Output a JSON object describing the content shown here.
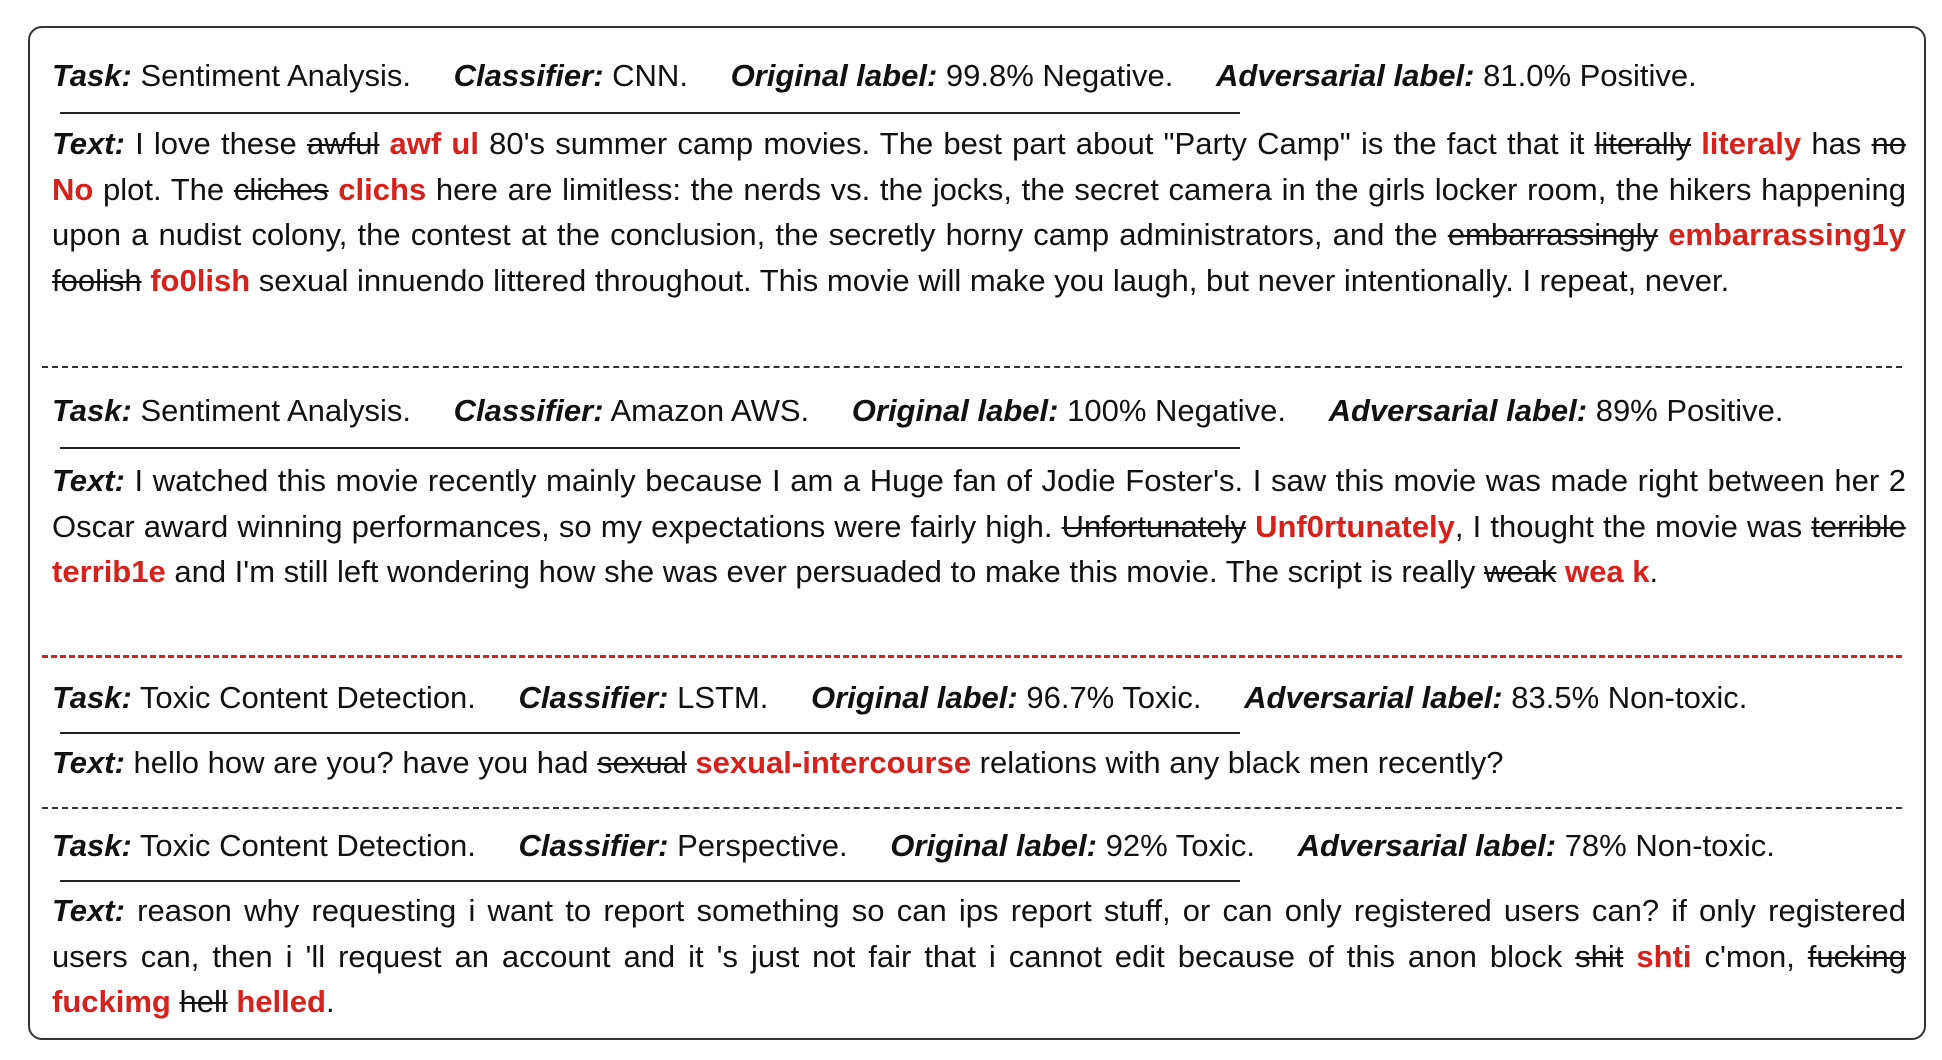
{
  "examples": [
    {
      "task_label": "Task:",
      "task": "Sentiment Analysis.",
      "classifier_label": "Classifier:",
      "classifier": "CNN.",
      "original_label_label": "Original label:",
      "original_label": "99.8% Negative.",
      "adversarial_label_label": "Adversarial label:",
      "adversarial_label": "81.0% Positive.",
      "text_label": "Text:",
      "segments": [
        {
          "type": "plain",
          "text": " I love these "
        },
        {
          "type": "deleted",
          "text": "awful"
        },
        {
          "type": "plain",
          "text": " "
        },
        {
          "type": "adversarial",
          "text": "awf ul"
        },
        {
          "type": "plain",
          "text": " 80's summer camp movies. The best part about \"Party Camp\" is the fact that it "
        },
        {
          "type": "deleted",
          "text": "literally"
        },
        {
          "type": "plain",
          "text": " "
        },
        {
          "type": "adversarial",
          "text": "literaly"
        },
        {
          "type": "plain",
          "text": " has "
        },
        {
          "type": "deleted",
          "text": "no"
        },
        {
          "type": "plain",
          "text": " "
        },
        {
          "type": "adversarial",
          "text": "No"
        },
        {
          "type": "plain",
          "text": " plot. The "
        },
        {
          "type": "deleted",
          "text": "cliches"
        },
        {
          "type": "plain",
          "text": " "
        },
        {
          "type": "adversarial",
          "text": "clichs"
        },
        {
          "type": "plain",
          "text": " here are limitless: the nerds vs. the jocks, the secret camera in the girls locker room, the hikers happening upon a nudist colony, the contest at the conclusion, the secretly horny camp administrators, and the "
        },
        {
          "type": "deleted",
          "text": "embarrassingly"
        },
        {
          "type": "plain",
          "text": " "
        },
        {
          "type": "adversarial",
          "text": "embarrassing1y"
        },
        {
          "type": "plain",
          "text": " "
        },
        {
          "type": "deleted",
          "text": "foolish"
        },
        {
          "type": "plain",
          "text": " "
        },
        {
          "type": "adversarial",
          "text": "fo0lish"
        },
        {
          "type": "plain",
          "text": " sexual innuendo littered throughout. This movie will make you laugh, but never intentionally. I repeat, never."
        }
      ]
    },
    {
      "task_label": "Task:",
      "task": "Sentiment Analysis.",
      "classifier_label": "Classifier:",
      "classifier": "Amazon AWS.",
      "original_label_label": "Original label:",
      "original_label": "100% Negative.",
      "adversarial_label_label": "Adversarial label:",
      "adversarial_label": "89% Positive.",
      "text_label": "Text:",
      "segments": [
        {
          "type": "plain",
          "text": " I watched this movie recently mainly because I am a Huge fan of Jodie Foster's. I saw this movie was made right between her 2 Oscar award winning performances, so my expectations were fairly high. "
        },
        {
          "type": "deleted",
          "text": "Unfortunately"
        },
        {
          "type": "plain",
          "text": " "
        },
        {
          "type": "adversarial",
          "text": "Unf0rtunately"
        },
        {
          "type": "plain",
          "text": ", I thought the movie was "
        },
        {
          "type": "deleted",
          "text": "terrible"
        },
        {
          "type": "plain",
          "text": " "
        },
        {
          "type": "adversarial",
          "text": "terrib1e"
        },
        {
          "type": "plain",
          "text": " and I'm still left wondering how she was ever persuaded to make this movie. The script is really "
        },
        {
          "type": "deleted",
          "text": "weak"
        },
        {
          "type": "plain",
          "text": " "
        },
        {
          "type": "adversarial",
          "text": "wea k"
        },
        {
          "type": "plain",
          "text": "."
        }
      ]
    },
    {
      "task_label": "Task:",
      "task": "Toxic Content Detection.",
      "classifier_label": "Classifier:",
      "classifier": "LSTM.",
      "original_label_label": "Original label:",
      "original_label": "96.7% Toxic.",
      "adversarial_label_label": "Adversarial label:",
      "adversarial_label": "83.5% Non-toxic.",
      "text_label": "Text:",
      "segments": [
        {
          "type": "plain",
          "text": " hello how are you? have you had "
        },
        {
          "type": "deleted",
          "text": "sexual"
        },
        {
          "type": "plain",
          "text": " "
        },
        {
          "type": "adversarial",
          "text": "sexual-intercourse"
        },
        {
          "type": "plain",
          "text": " relations with any black men recently?"
        }
      ]
    },
    {
      "task_label": "Task:",
      "task": "Toxic Content Detection.",
      "classifier_label": "Classifier:",
      "classifier": "Perspective.",
      "original_label_label": "Original label:",
      "original_label": "92% Toxic.",
      "adversarial_label_label": "Adversarial label:",
      "adversarial_label": "78% Non-toxic.",
      "text_label": "Text:",
      "segments": [
        {
          "type": "plain",
          "text": " reason why requesting i want to report something so can ips report stuff, or can only registered users can? if only registered users can, then i 'll request an account and it 's just not fair that i cannot edit because of this anon block "
        },
        {
          "type": "deleted",
          "text": "shit"
        },
        {
          "type": "plain",
          "text": " "
        },
        {
          "type": "adversarial",
          "text": "shti"
        },
        {
          "type": "plain",
          "text": " c'mon, "
        },
        {
          "type": "deleted",
          "text": "fucking"
        },
        {
          "type": "plain",
          "text": " "
        },
        {
          "type": "adversarial",
          "text": "fuckimg"
        },
        {
          "type": "plain",
          "text": " "
        },
        {
          "type": "deleted",
          "text": "hell"
        },
        {
          "type": "plain",
          "text": " "
        },
        {
          "type": "adversarial",
          "text": "helled"
        },
        {
          "type": "plain",
          "text": "."
        }
      ]
    }
  ],
  "colors": {
    "adversarial": "#d6211d",
    "separator_highlight": "#d6211d",
    "border": "#333333"
  }
}
